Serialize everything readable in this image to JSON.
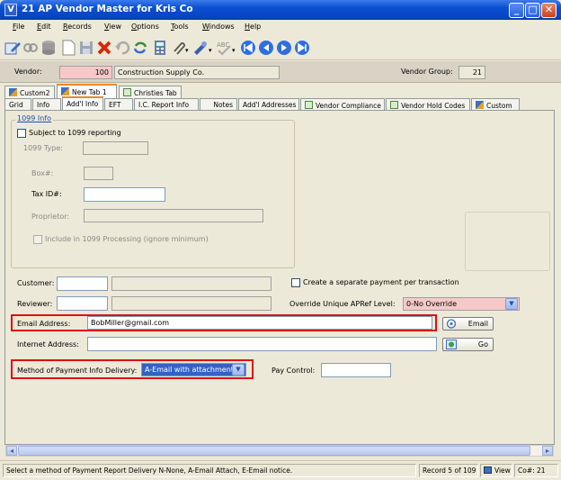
{
  "window": {
    "title": "21 AP Vendor Master for Kris Co",
    "app_icon_letter": "V"
  },
  "menu": [
    {
      "label": "File",
      "u": "F"
    },
    {
      "label": "Edit",
      "u": "E"
    },
    {
      "label": "Records",
      "u": "R"
    },
    {
      "label": "View",
      "u": "V"
    },
    {
      "label": "Options",
      "u": "O"
    },
    {
      "label": "Tools",
      "u": "T"
    },
    {
      "label": "Windows",
      "u": "W"
    },
    {
      "label": "Help",
      "u": "H"
    }
  ],
  "vendor": {
    "vendor_label": "Vendor:",
    "vendor_number": "100",
    "vendor_name": "Construction Supply Co.",
    "group_label": "Vendor Group:",
    "group_value": "21"
  },
  "tabs_row1": [
    "Custom2",
    "New Tab 1",
    "Christies Tab"
  ],
  "tabs_row2": [
    "Grid",
    "Info",
    "Add'l Info",
    "EFT",
    "I.C. Report Info",
    "Notes",
    "Add'l Addresses",
    "Vendor Compliance",
    "Vendor Hold Codes",
    "Custom"
  ],
  "form": {
    "group_1099_title": "1099 Info",
    "subject_1099": "Subject to 1099 reporting",
    "type_1099": "1099 Type:",
    "box": "Box#:",
    "tax_id": "Tax ID#:",
    "proprietor": "Proprietor:",
    "include_1099": "Include in 1099 Processing (ignore minimum)",
    "customer": "Customer:",
    "reviewer": "Reviewer:",
    "create_separate": "Create a separate payment per transaction",
    "override_label": "Override Unique APRef Level:",
    "override_value": "0-No Override",
    "email_label": "Email Address:",
    "email_value": "BobMiller@gmail.com",
    "email_button": "Email",
    "internet_label": "Internet Address:",
    "go_button": "Go",
    "method_label": "Method of Payment Info Delivery:",
    "method_value": "A-Email with attachment",
    "pay_control": "Pay Control:"
  },
  "status": {
    "message": "Select a method of Payment Report Delivery N-None, A-Email Attach, E-Email notice.",
    "record": "Record 5 of 109",
    "mode": "View",
    "company": "Co#: 21"
  },
  "colors": {
    "title_blue": "#0a4fd0",
    "highlight_red": "#e01010",
    "pink_field": "#f6c8c8",
    "selected_blue": "#3163c5"
  }
}
